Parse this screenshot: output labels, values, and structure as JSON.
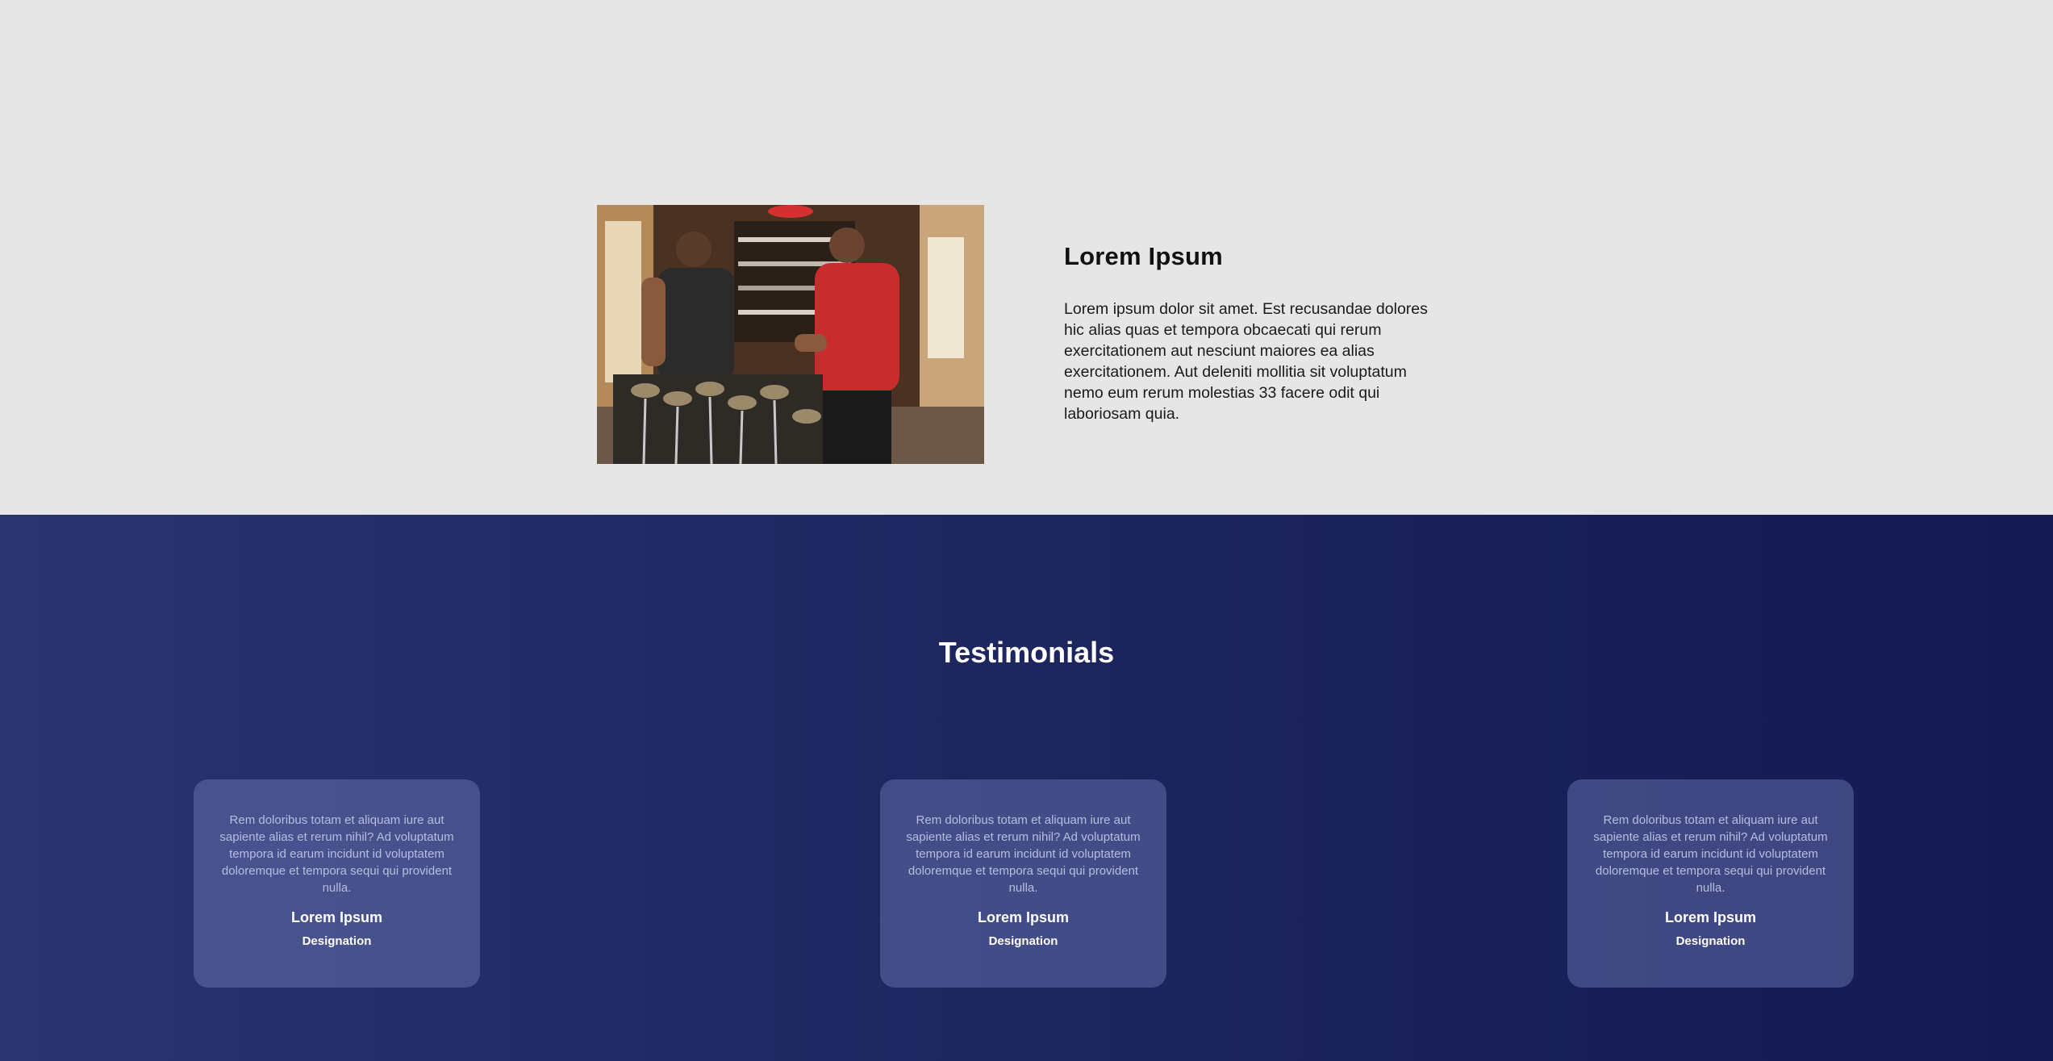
{
  "about": {
    "title": "Lorem Ipsum",
    "body": "Lorem ipsum dolor sit amet. Est recusandae dolores hic alias quas et tempora obcaecati qui rerum exercitationem aut nesciunt maiores ea alias exercitationem. Aut deleniti mollitia sit voluptatum nemo eum rerum molestias 33 facere odit qui laboriosam quia."
  },
  "testimonials": {
    "heading": "Testimonials",
    "cards": [
      {
        "quote": "Rem doloribus totam et aliquam iure aut sapiente alias et rerum nihil? Ad voluptatum tempora id earum incidunt id voluptatem doloremque et tempora sequi qui provident nulla.",
        "name": "Lorem Ipsum",
        "designation": "Designation"
      },
      {
        "quote": "Rem doloribus totam et aliquam iure aut sapiente alias et rerum nihil? Ad voluptatum tempora id earum incidunt id voluptatem doloremque et tempora sequi qui provident nulla.",
        "name": "Lorem Ipsum",
        "designation": "Designation"
      },
      {
        "quote": "Rem doloribus totam et aliquam iure aut sapiente alias et rerum nihil? Ad voluptatum tempora id earum incidunt id voluptatem doloremque et tempora sequi qui provident nulla.",
        "name": "Lorem Ipsum",
        "designation": "Designation"
      }
    ]
  },
  "colors": {
    "about_bg": "#e6e6e6",
    "testimonials_bg_start": "#2a3470",
    "testimonials_bg_end": "#141a52",
    "card_bg": "#4a5288"
  }
}
